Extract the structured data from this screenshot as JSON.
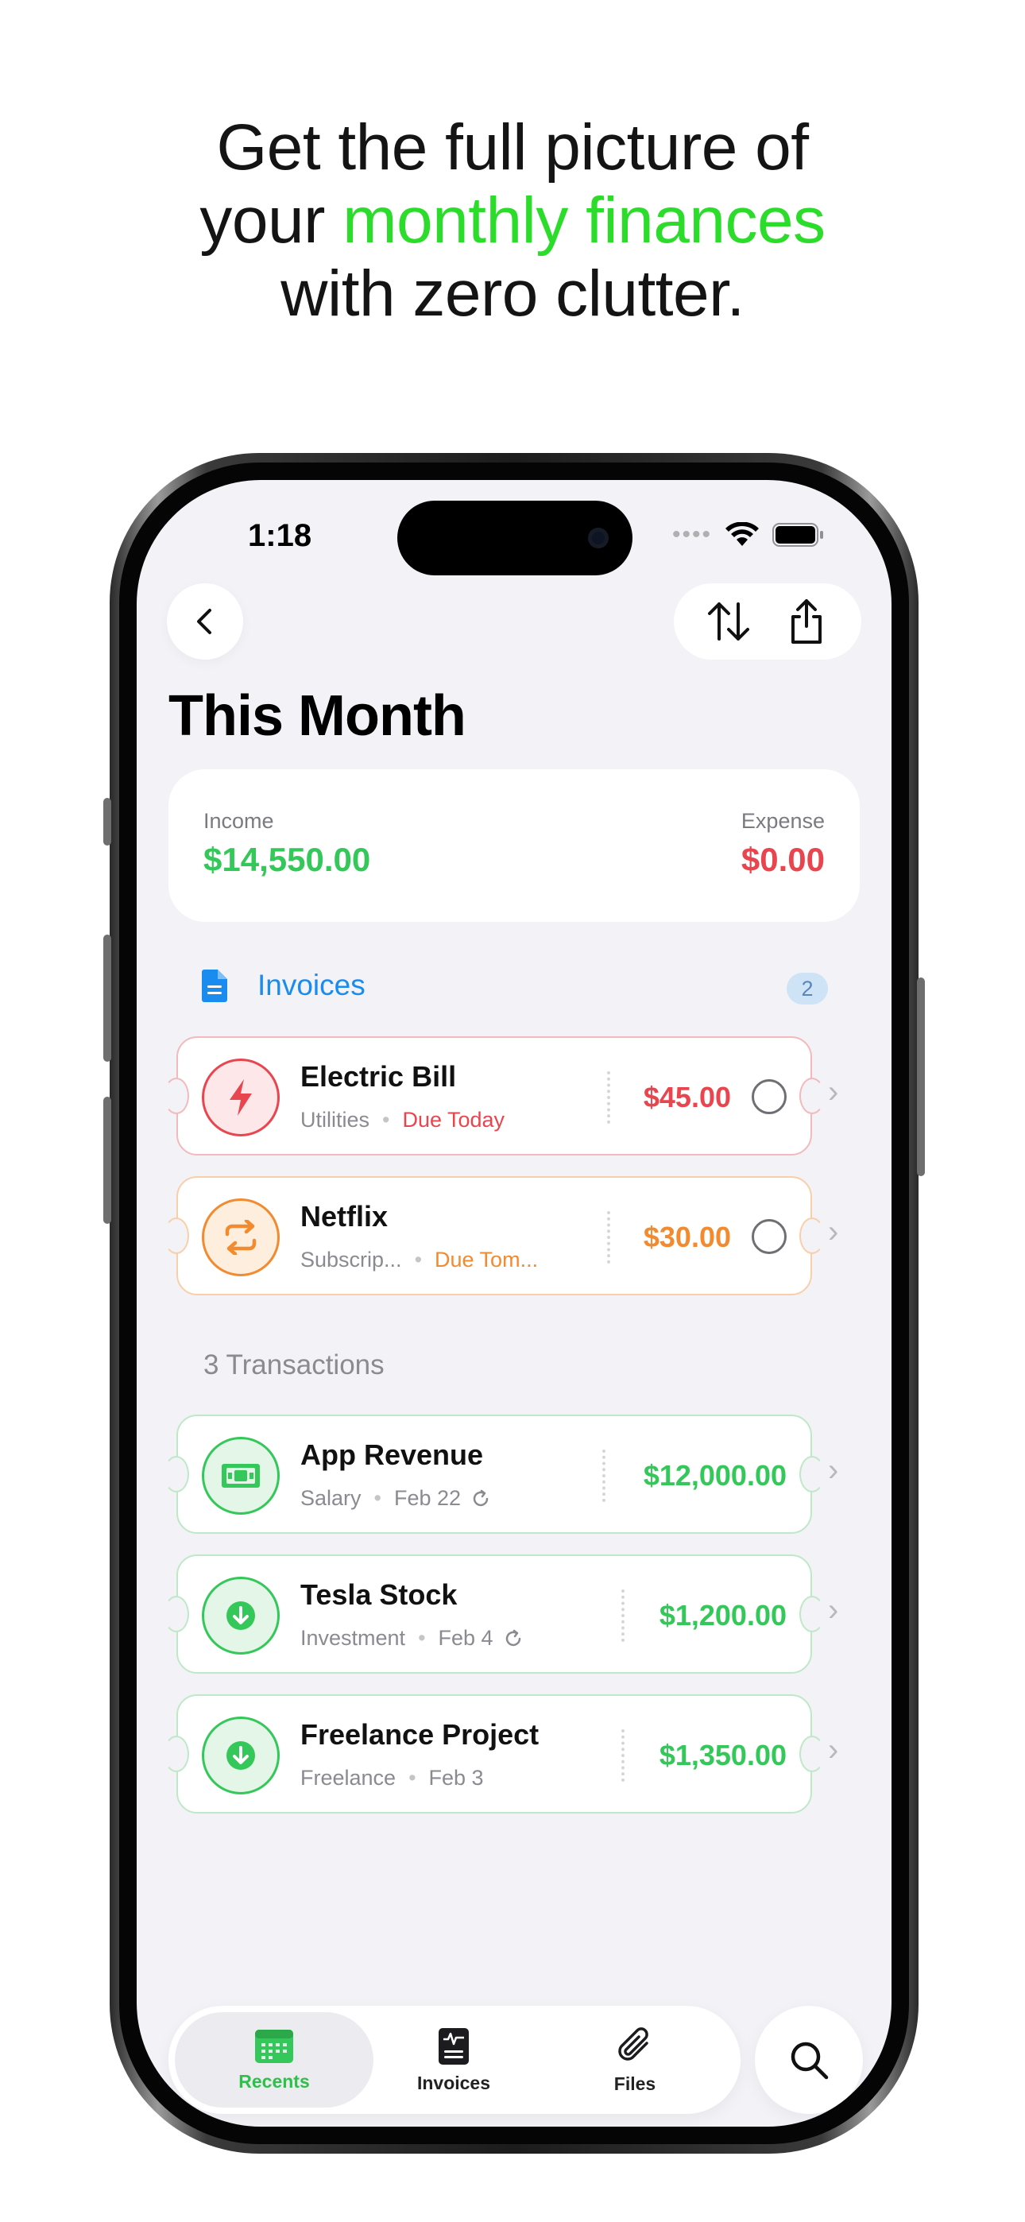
{
  "headline": {
    "line1": "Get the full picture of",
    "line2_pre": "your ",
    "line2_accent": "monthly finances",
    "line3": "with zero clutter."
  },
  "status_bar": {
    "time": "1:18"
  },
  "page": {
    "title": "This Month"
  },
  "summary": {
    "income_label": "Income",
    "income_value": "$14,550.00",
    "expense_label": "Expense",
    "expense_value": "$0.00"
  },
  "invoices": {
    "label": "Invoices",
    "count": "2",
    "items": [
      {
        "title": "Electric Bill",
        "category": "Utilities",
        "due": "Due Today",
        "amount": "$45.00",
        "icon": "bolt-icon",
        "color": "#e8454f"
      },
      {
        "title": "Netflix",
        "category": "Subscrip...",
        "due": "Due Tom...",
        "amount": "$30.00",
        "icon": "repeat-icon",
        "color": "#f28a30"
      }
    ]
  },
  "transactions": {
    "label": "3 Transactions",
    "items": [
      {
        "title": "App Revenue",
        "category": "Salary",
        "date": "Feb 22",
        "recurring": true,
        "amount": "$12,000.00",
        "icon": "cash-icon"
      },
      {
        "title": "Tesla Stock",
        "category": "Investment",
        "date": "Feb 4",
        "recurring": true,
        "amount": "$1,200.00",
        "icon": "arrow-down-circle-icon"
      },
      {
        "title": "Freelance Project",
        "category": "Freelance",
        "date": "Feb 3",
        "recurring": false,
        "amount": "$1,350.00",
        "icon": "arrow-down-circle-icon"
      }
    ]
  },
  "tabbar": {
    "tabs": [
      {
        "label": "Recents",
        "icon": "calendar-icon",
        "active": true
      },
      {
        "label": "Invoices",
        "icon": "invoice-icon",
        "active": false
      },
      {
        "label": "Files",
        "icon": "paperclip-icon",
        "active": false
      }
    ]
  },
  "colors": {
    "accent_green": "#2fbf4a",
    "headline_green": "#2bdc2b",
    "expense_red": "#e8454f",
    "invoice_blue": "#1a8cf0",
    "warning_orange": "#f28a30"
  }
}
